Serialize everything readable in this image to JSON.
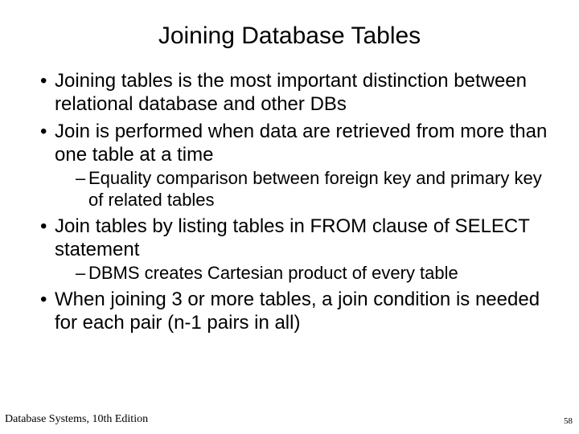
{
  "title": "Joining Database Tables",
  "bullets": {
    "b1": "Joining tables is the most important distinction between relational database and other DBs",
    "b2": "Join is performed when data are retrieved from more than one table at a time",
    "b2s1": "Equality comparison between foreign key and primary key of related tables",
    "b3": "Join tables by listing tables in FROM clause of SELECT statement",
    "b3s1": "DBMS creates Cartesian product of every table",
    "b4": "When joining 3 or more tables, a join condition is needed for each pair (n-1 pairs in all)"
  },
  "footer": "Database Systems, 10th Edition",
  "page": "58"
}
